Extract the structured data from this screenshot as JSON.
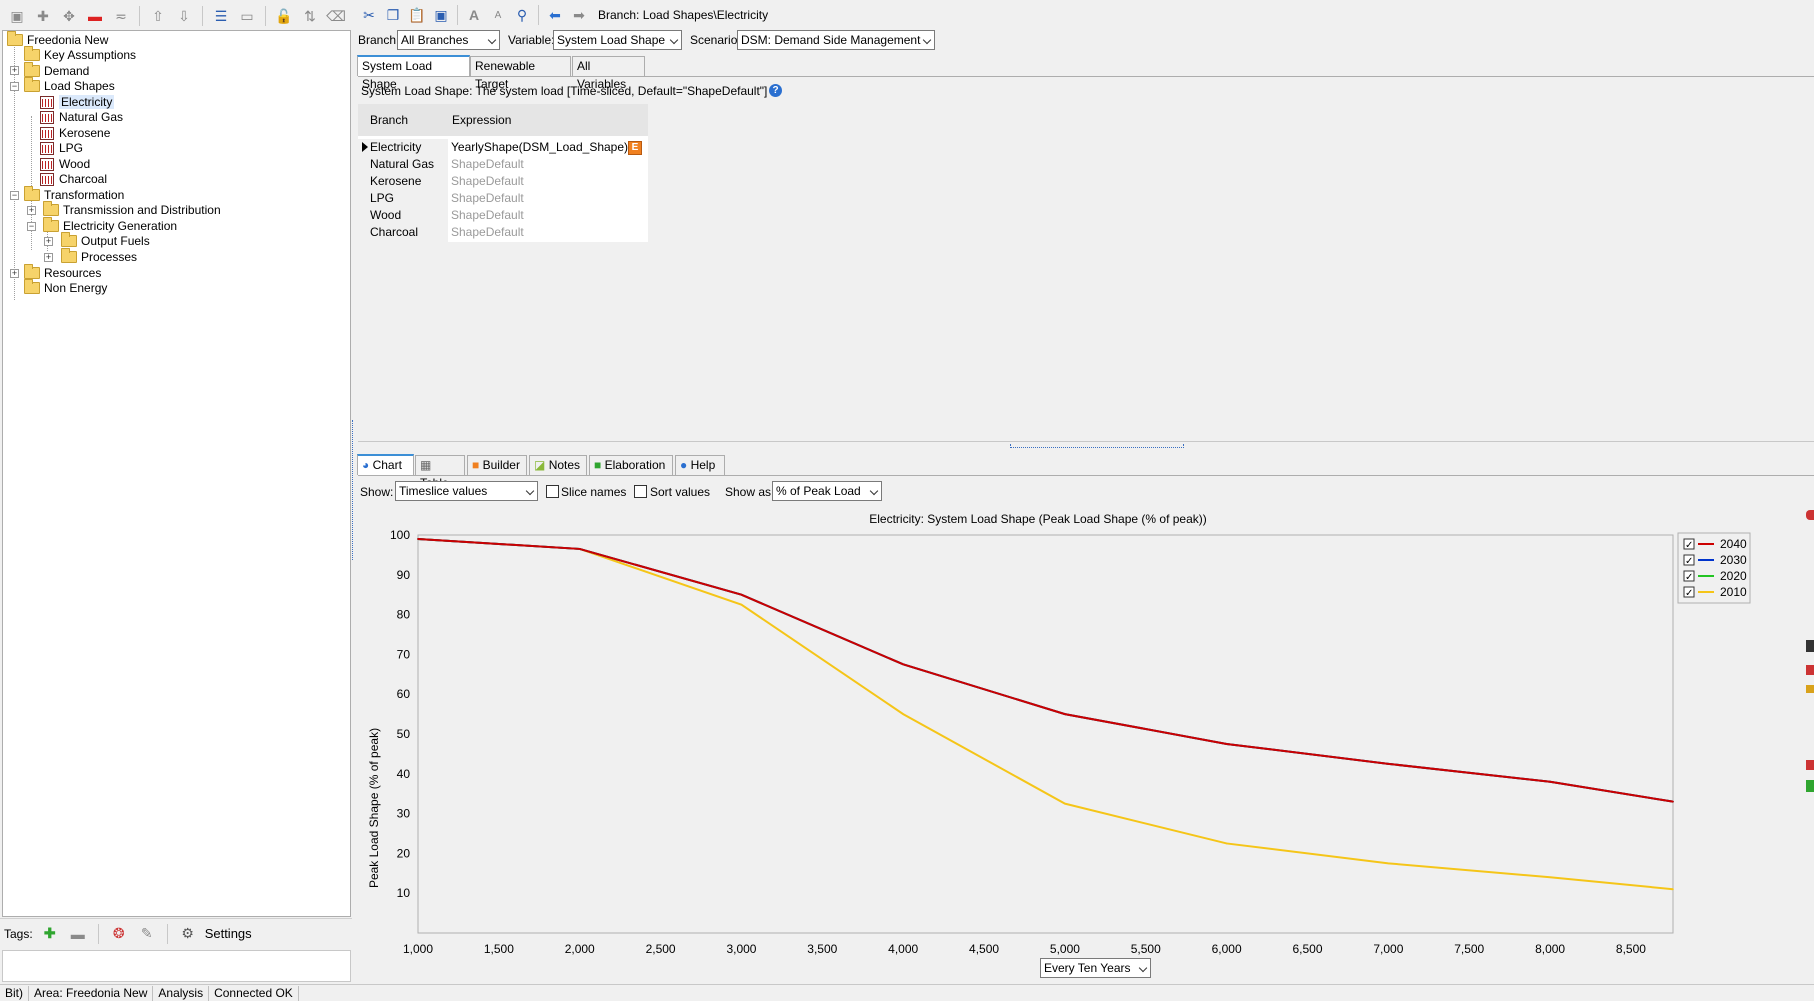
{
  "tree": {
    "root": "Freedonia New",
    "items": [
      {
        "label": "Key Assumptions"
      },
      {
        "label": "Demand"
      },
      {
        "label": "Load Shapes"
      },
      {
        "label": "Electricity"
      },
      {
        "label": "Natural Gas"
      },
      {
        "label": "Kerosene"
      },
      {
        "label": "LPG"
      },
      {
        "label": "Wood"
      },
      {
        "label": "Charcoal"
      },
      {
        "label": "Transformation"
      },
      {
        "label": "Transmission and Distribution"
      },
      {
        "label": "Electricity Generation"
      },
      {
        "label": "Output Fuels"
      },
      {
        "label": "Processes"
      },
      {
        "label": "Resources"
      },
      {
        "label": "Non Energy"
      }
    ]
  },
  "tags": {
    "label": "Tags:",
    "settings": "Settings"
  },
  "status": {
    "mode": "Bit)",
    "area": "Area: Freedonia New",
    "view": "Analysis",
    "connection": "Connected OK"
  },
  "header": {
    "breadcrumb": "Branch: Load Shapes\\Electricity",
    "branch_label": "Branch:",
    "branch_value": "All Branches",
    "variable_label": "Variable:",
    "variable_value": "System Load Shape",
    "scenario_label": "Scenario:",
    "scenario_value": "DSM: Demand Side Management"
  },
  "var_tabs": [
    "System Load Shape",
    "Renewable Target",
    "All Variables"
  ],
  "var_description": "System Load Shape: The system load [Time-sliced, Default=\"ShapeDefault\"]",
  "grid": {
    "headers": [
      "Branch",
      "Expression"
    ],
    "rows": [
      {
        "branch": "Electricity",
        "expression": "YearlyShape(DSM_Load_Shape)"
      },
      {
        "branch": "Natural Gas",
        "expression": "ShapeDefault"
      },
      {
        "branch": "Kerosene",
        "expression": "ShapeDefault"
      },
      {
        "branch": "LPG",
        "expression": "ShapeDefault"
      },
      {
        "branch": "Wood",
        "expression": "ShapeDefault"
      },
      {
        "branch": "Charcoal",
        "expression": "ShapeDefault"
      }
    ],
    "badge": "E"
  },
  "bottom_tabs": [
    "Chart",
    "Table",
    "Builder",
    "Notes",
    "Elaboration",
    "Help"
  ],
  "chart_controls": {
    "show_label": "Show:",
    "show_value": "Timeslice values",
    "slice_names": "Slice names",
    "sort_values": "Sort values",
    "show_as_label": "Show as:",
    "show_as_value": "% of Peak Load",
    "period_value": "Every Ten Years"
  },
  "chart_data": {
    "type": "line",
    "title": "Electricity: System Load Shape (Peak Load Shape (% of peak))",
    "xlabel": "",
    "ylabel": "Peak Load Shape (% of peak)",
    "xlim": [
      1000,
      8760
    ],
    "ylim": [
      0,
      100
    ],
    "x_ticks": [
      "1,000",
      "1,500",
      "2,000",
      "2,500",
      "3,000",
      "3,500",
      "4,000",
      "4,500",
      "5,000",
      "5,500",
      "6,000",
      "6,500",
      "7,000",
      "7,500",
      "8,000",
      "8,500"
    ],
    "y_ticks": [
      "100",
      "90",
      "80",
      "70",
      "60",
      "50",
      "40",
      "30",
      "20",
      "10"
    ],
    "x": [
      1000,
      2000,
      3000,
      4000,
      5000,
      6000,
      7000,
      8000,
      8760
    ],
    "series": [
      {
        "name": "2040",
        "color": "#cc0000",
        "values": [
          99,
          96.5,
          85,
          67.5,
          55,
          47.5,
          42.5,
          38,
          33
        ]
      },
      {
        "name": "2030",
        "color": "#0033cc",
        "values": [
          99,
          96.5,
          85,
          67.5,
          55,
          47.5,
          42.5,
          38,
          33
        ]
      },
      {
        "name": "2020",
        "color": "#22c422",
        "values": [
          99,
          96.5,
          85,
          67.5,
          55,
          47.5,
          42.5,
          38,
          33
        ]
      },
      {
        "name": "2010",
        "color": "#f5c518",
        "values": [
          99,
          96.5,
          82.5,
          55,
          32.5,
          22.5,
          17.5,
          14,
          11
        ]
      }
    ],
    "legend": "top-right",
    "grid": false
  }
}
